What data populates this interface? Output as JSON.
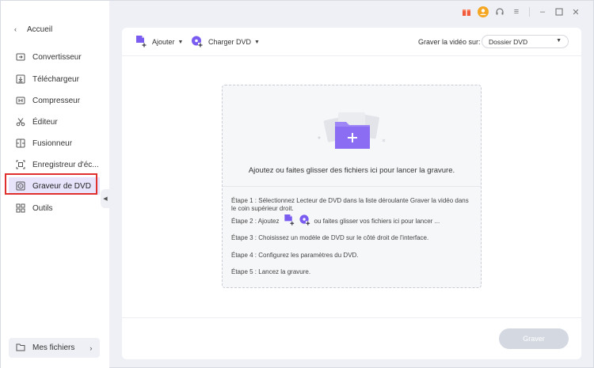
{
  "sidebar": {
    "back_label": "Accueil",
    "items": [
      {
        "label": "Convertisseur",
        "icon": "convert-icon"
      },
      {
        "label": "Téléchargeur",
        "icon": "download-icon"
      },
      {
        "label": "Compresseur",
        "icon": "compress-icon"
      },
      {
        "label": "Éditeur",
        "icon": "scissors-icon"
      },
      {
        "label": "Fusionneur",
        "icon": "merge-icon"
      },
      {
        "label": "Enregistreur d'éc...",
        "icon": "screen-record-icon"
      },
      {
        "label": "Graveur de DVD",
        "icon": "dvd-icon",
        "active": true
      },
      {
        "label": "Outils",
        "icon": "tools-icon"
      }
    ],
    "my_files_label": "Mes fichiers"
  },
  "toolbar": {
    "add_label": "Ajouter",
    "load_dvd_label": "Charger DVD",
    "burn_to_label": "Graver la vidéo sur:",
    "burn_to_value": "Dossier DVD"
  },
  "dropzone": {
    "prompt": "Ajoutez ou faites glisser des fichiers ici pour lancer la gravure.",
    "step1": "Étape 1 : Sélectionnez Lecteur de DVD dans la liste déroulante Graver la vidéo dans le coin supérieur droit.",
    "step2_prefix": "Étape 2 : Ajoutez",
    "step2_suffix": "ou faites glisser vos fichiers ici pour lancer ...",
    "step3": "Étape 3 : Choisissez un modèle de DVD sur le côté droit de l'interface.",
    "step4": "Étape 4 : Configurez les paramètres du DVD.",
    "step5": "Étape 5 : Lancez la gravure."
  },
  "footer": {
    "burn_label": "Graver"
  },
  "colors": {
    "accent": "#7b5cf0",
    "active_bg": "#e7e4fb",
    "highlight": "#e0302e",
    "disabled_button": "#d4d8e1"
  }
}
